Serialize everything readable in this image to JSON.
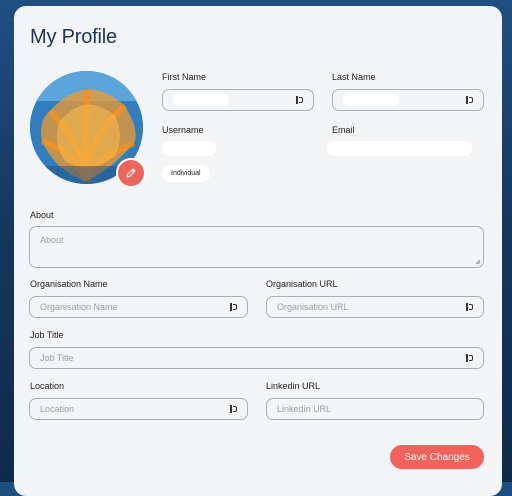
{
  "page": {
    "title": "My Profile"
  },
  "profile": {
    "account_type": "Individual"
  },
  "fields": {
    "first_name": {
      "label": "First Name",
      "value": ""
    },
    "last_name": {
      "label": "Last Name",
      "value": ""
    },
    "username": {
      "label": "Username",
      "value": ""
    },
    "email": {
      "label": "Email",
      "value": ""
    },
    "about": {
      "label": "About",
      "placeholder": "About"
    },
    "organisation_name": {
      "label": "Organisation Name",
      "placeholder": "Organisation Name"
    },
    "organisation_url": {
      "label": "Organisation URL",
      "placeholder": "Organisation URL"
    },
    "job_title": {
      "label": "Job Title",
      "placeholder": "Job Title"
    },
    "location": {
      "label": "Location",
      "placeholder": "Location"
    },
    "linkedin_url": {
      "label": "Linkedin URL",
      "placeholder": "Linkedin URL"
    }
  },
  "actions": {
    "save_label": "Save Changes"
  },
  "colors": {
    "accent": "#f0635b",
    "title": "#1d3557",
    "card": "#f3f4f6"
  },
  "icons": {
    "edit": "pencil-icon",
    "field_helper": "password-manager-key-icon"
  }
}
